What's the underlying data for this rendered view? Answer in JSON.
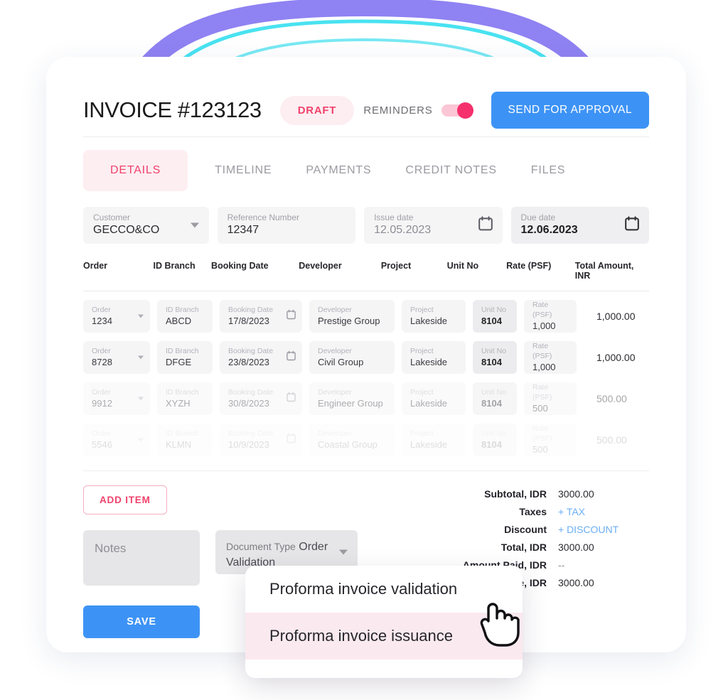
{
  "header": {
    "title": "INVOICE #123123",
    "status_badge": "DRAFT",
    "reminders_label": "REMINDERS",
    "reminders_on": true,
    "send_button": "SEND FOR APPROVAL"
  },
  "tabs": [
    {
      "label": "DETAILS",
      "active": true
    },
    {
      "label": "TIMELINE",
      "active": false
    },
    {
      "label": "PAYMENTS",
      "active": false
    },
    {
      "label": "CREDIT NOTES",
      "active": false
    },
    {
      "label": "FILES",
      "active": false
    }
  ],
  "form": {
    "customer": {
      "label": "Customer",
      "value": "GECCO&CO"
    },
    "reference": {
      "label": "Reference Number",
      "value": "12347"
    },
    "issue_date": {
      "label": "Issue date",
      "value": "12.05.2023"
    },
    "due_date": {
      "label": "Due date",
      "value": "12.06.2023"
    }
  },
  "table": {
    "columns": [
      "Order",
      "ID Branch",
      "Booking Date",
      "Developer",
      "Project",
      "Unit No",
      "Rate (PSF)",
      "Total Amount, INR"
    ],
    "field_labels": {
      "order": "Order",
      "branch": "ID Branch",
      "booking": "Booking Date",
      "developer": "Developer",
      "project": "Project",
      "unit": "Unit No",
      "rate": "Rate (PSF)"
    },
    "rows": [
      {
        "order": "1234",
        "branch": "ABCD",
        "booking": "17/8/2023",
        "developer": "Prestige Group",
        "project": "Lakeside",
        "unit": "8104",
        "rate": "1,000",
        "total": "1,000.00"
      },
      {
        "order": "8728",
        "branch": "DFGE",
        "booking": "23/8/2023",
        "developer": "Civil Group",
        "project": "Lakeside",
        "unit": "8104",
        "rate": "1,000",
        "total": "1,000.00"
      },
      {
        "order": "9912",
        "branch": "XYZH",
        "booking": "30/8/2023",
        "developer": "Engineer Group",
        "project": "Lakeside",
        "unit": "8104",
        "rate": "500",
        "total": "500.00"
      },
      {
        "order": "5546",
        "branch": "KLMN",
        "booking": "10/9/2023",
        "developer": "Coastal Group",
        "project": "Lakeside",
        "unit": "8104",
        "rate": "500",
        "total": "500.00"
      }
    ]
  },
  "actions": {
    "add_item": "ADD ITEM",
    "save": "SAVE"
  },
  "notes": {
    "placeholder": "Notes"
  },
  "document_type": {
    "label": "Document Type",
    "value": "Order Validation",
    "options": [
      {
        "label": "Proforma invoice validation",
        "highlighted": false
      },
      {
        "label": "Proforma invoice issuance",
        "highlighted": true
      }
    ]
  },
  "totals": [
    {
      "label": "Subtotal, IDR",
      "value": "3000.00",
      "style": "plain"
    },
    {
      "label": "Taxes",
      "value": "+ TAX",
      "style": "link"
    },
    {
      "label": "Discount",
      "value": "+ DISCOUNT",
      "style": "link"
    },
    {
      "label": "Total, IDR",
      "value": "3000.00",
      "style": "plain"
    },
    {
      "label": "Amount Paid, IDR",
      "value": "--",
      "style": "dim"
    },
    {
      "label": "Balance Due, IDR",
      "value": "3000.00",
      "style": "plain"
    }
  ],
  "colors": {
    "accent_pink": "#f0426b",
    "accent_blue": "#3d93f5",
    "badge_bg": "#fdeef2",
    "decor_purple": "#7b6cf0",
    "decor_cyan": "#3fe0f0"
  }
}
